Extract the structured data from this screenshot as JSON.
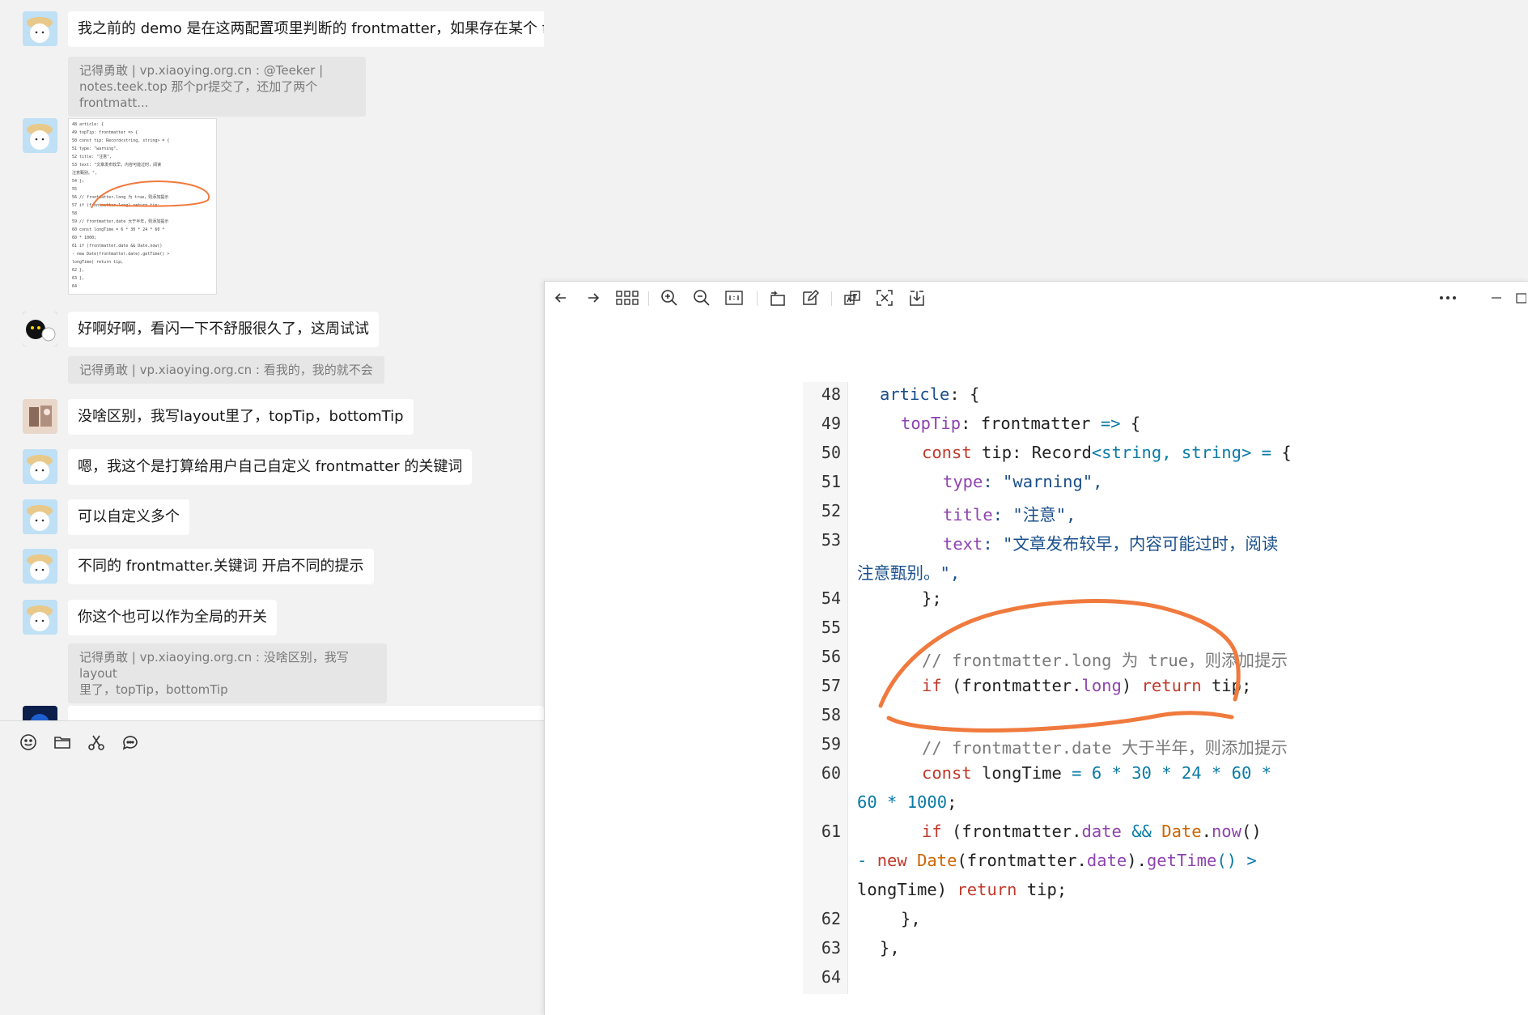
{
  "chat": {
    "messages": [
      {
        "text": "我之前的 demo 是在这两配置项里判断的 frontmatter，如果存在某个 frontmatter.xx，则显示或者不显示"
      },
      {
        "quote_line1": "记得勇敢 | vp.xiaoying.org.cn : @Teeker |",
        "quote_line2": "notes.teek.top 那个pr提交了，还加了两个frontmatt..."
      },
      {
        "text": "好啊好啊，看闪一下不舒服很久了，这周试试"
      },
      {
        "quote": "记得勇敢 | vp.xiaoying.org.cn : 看我的，我的就不会"
      },
      {
        "text": "没啥区别，我写layout里了，topTip，bottomTip"
      },
      {
        "text": "嗯，我这个是打算给用户自己自定义 frontmatter 的关键词"
      },
      {
        "text": "可以自定义多个"
      },
      {
        "text": "不同的 frontmatter.关键词 开启不同的提示"
      },
      {
        "text": "你这个也可以作为全局的开关"
      },
      {
        "quote_line1": "记得勇敢 | vp.xiaoying.org.cn : 没啥区别，我写layout",
        "quote_line2": "里了，topTip，bottomTip"
      }
    ],
    "thumbnail_lines": [
      "48   article: {",
      "49     topTip: frontmatter => {",
      "50       const tip: Record<string, string> = {",
      "51         type: \"warning\",",
      "52         title: \"注意\",",
      "53         text: \"文章发布较早，内容可能过时，阅读",
      "注意甄别。\",",
      "54       };",
      "55",
      "56       // frontmatter.long 为 true，则添加提示",
      "57       if (frontmatter.long) return tip;",
      "58",
      "59       // frontmatter.date 大于半年，则添加提示",
      "60       const longTime = 6 * 30 * 24 * 60 *",
      "60 * 1000;",
      "61       if (frontmatter.date && Date.now()",
      "- new Date(frontmatter.date).getTime() >",
      "longTime) return tip;",
      "62     },",
      "63   },",
      "64"
    ],
    "compose_icons": [
      "emoji-icon",
      "folder-icon",
      "scissors-icon",
      "chat-history-icon"
    ]
  },
  "viewer": {
    "toolbar_icons": [
      "back-arrow-icon",
      "forward-arrow-icon",
      "grid-icon",
      "zoom-in-icon",
      "zoom-out-icon",
      "actual-size-icon",
      "rotate-icon",
      "edit-icon",
      "translate-icon",
      "ocr-icon",
      "download-icon",
      "more-icon",
      "minimize-icon"
    ],
    "line_numbers": {
      "l48": "48",
      "l49": "49",
      "l50": "50",
      "l51": "51",
      "l52": "52",
      "l53": "53",
      "l54": "54",
      "l55": "55",
      "l56": "56",
      "l57": "57",
      "l58": "58",
      "l59": "59",
      "l60": "60",
      "l61": "61",
      "l62": "62",
      "l63": "63",
      "l64": "64"
    },
    "code": {
      "article": "article",
      "colon_brace": ": {",
      "topTip": "topTip",
      "frontmatter_arrow": ": frontmatter ",
      "arrow": "=>",
      "brace": " {",
      "const": "const",
      "tip_record": " tip: Record",
      "lt_string": "<string, string>",
      "eq": " =",
      "type": "type",
      "type_val": ": \"warning\",",
      "title": "title",
      "title_val": ": \"注意\",",
      "text": "text",
      "text_val": ": \"文章发布较早，内容可能过时，阅读",
      "text_cont": "注意甄别。\",",
      "close_semicolon": "};",
      "comment_long": "// frontmatter.long 为 true，则添加提示",
      "if": "if",
      "if_long_open": " (frontmatter.",
      "long": "long",
      "paren_close": ") ",
      "return": "return",
      "tip_semi": " tip;",
      "comment_date": "// frontmatter.date 大于半年，则添加提示",
      "longTime": " longTime ",
      "longTime_expr": "= 6 * 30 * 24 * 60 *",
      "longTime_cont": "60 * 1000",
      "semi": ";",
      "if_date_open": " (frontmatter.",
      "date": "date",
      "and": " && ",
      "Date": "Date",
      "dot": ".",
      "now": "now",
      "parens": "()",
      "minus": "- ",
      "new": "new",
      "space": " ",
      "Date2": "Date",
      "fm_date": "(frontmatter.",
      "date2": "date",
      "getTime_open": ").",
      "getTime": "getTime",
      "gt": "() >",
      "longTime_ret": "longTime) ",
      "return2": "return",
      "tip_semi2": " tip;",
      "close_comma1": "},",
      "close_comma2": "},"
    },
    "annotation_color": "#f07a3e"
  }
}
